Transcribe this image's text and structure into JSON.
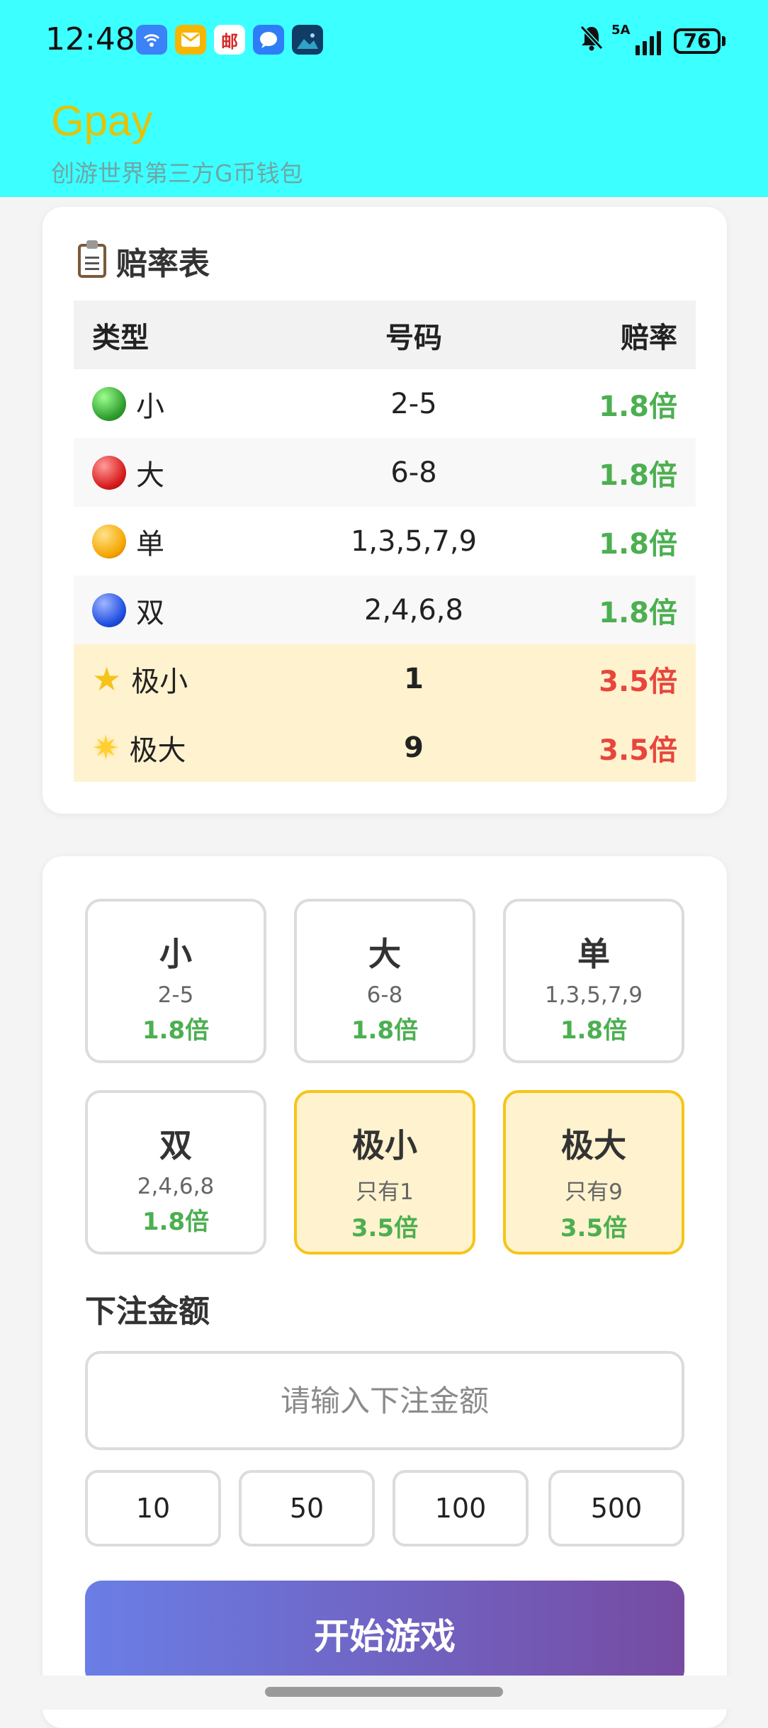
{
  "status_bar": {
    "time": "12:48",
    "notification_icons": [
      "wifi-share-icon",
      "mail-icon",
      "post-icon",
      "chat-icon",
      "photo-icon"
    ],
    "post_icon_text": "邮",
    "signal_label": "5A",
    "battery": "76"
  },
  "header": {
    "title": "Gpay",
    "subtitle": "创游世界第三方G币钱包",
    "bg_color": "#3cffff",
    "title_color": "#e6c200"
  },
  "odds_table": {
    "title": "赔率表",
    "headers": [
      "类型",
      "号码",
      "赔率"
    ],
    "rows": [
      {
        "icon": "green-ball-icon",
        "type": "小",
        "numbers": "2-5",
        "odds": "1.8倍"
      },
      {
        "icon": "red-ball-icon",
        "type": "大",
        "numbers": "6-8",
        "odds": "1.8倍"
      },
      {
        "icon": "orange-ball-icon",
        "type": "单",
        "numbers": "1,3,5,7,9",
        "odds": "1.8倍"
      },
      {
        "icon": "blue-ball-icon",
        "type": "双",
        "numbers": "2,4,6,8",
        "odds": "1.8倍"
      },
      {
        "icon": "star-icon",
        "type": "极小",
        "numbers": "1",
        "odds": "3.5倍"
      },
      {
        "icon": "glowing-star-icon",
        "type": "极大",
        "numbers": "9",
        "odds": "3.5倍"
      }
    ]
  },
  "bet_options": [
    {
      "title": "小",
      "range": "2-5",
      "odds": "1.8倍"
    },
    {
      "title": "大",
      "range": "6-8",
      "odds": "1.8倍"
    },
    {
      "title": "单",
      "range": "1,3,5,7,9",
      "odds": "1.8倍"
    },
    {
      "title": "双",
      "range": "2,4,6,8",
      "odds": "1.8倍"
    },
    {
      "title": "极小",
      "range": "只有1",
      "odds": "3.5倍"
    },
    {
      "title": "极大",
      "range": "只有9",
      "odds": "3.5倍"
    }
  ],
  "amount": {
    "label": "下注金额",
    "placeholder": "请输入下注金额",
    "value": "",
    "quick_amounts": [
      "10",
      "50",
      "100",
      "500"
    ]
  },
  "start_button": "开始游戏",
  "colors": {
    "green": "#4caf50",
    "red": "#e8453c",
    "highlight": "#fff2cf",
    "highlight_border": "#f5c518",
    "button_gradient": [
      "#6a7ee6",
      "#764ba2"
    ]
  }
}
